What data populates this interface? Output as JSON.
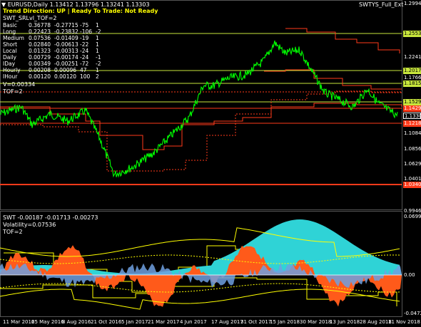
{
  "symbol_header": "EURUSD,Daily 1.13412 1.13796 1.13241 1.13303",
  "indicator_name_top_right": "SWTYS_Full_Ext",
  "status": {
    "trend_label": "Trend Direction: ",
    "trend_value": "UP",
    "sep": "|",
    "ready_label": "Ready To Trade: ",
    "ready_value": "Not Ready"
  },
  "swt_title": "SWT_SRLvl_TOF=2",
  "stats_rows": [
    [
      "Basic",
      "0.36778",
      "-0.27715",
      "-75",
      "1"
    ],
    [
      "Long",
      "0.22423",
      "-0.23832",
      "-106",
      "-2"
    ],
    [
      "Medium",
      "0.07536",
      "-0.01409",
      "-19",
      "1"
    ],
    [
      "Short",
      "0.02840",
      "-0.00613",
      "-22",
      "1"
    ],
    [
      "Local",
      "0.01323",
      "-0.00313",
      "-24",
      "1"
    ],
    [
      "Daily",
      "0.00729",
      "-0.00174",
      "-24",
      "-1"
    ],
    [
      "IDay",
      "0.00349",
      "-0.00251",
      "-72",
      "-2"
    ],
    [
      "Hourly",
      "0.00208",
      "0.00096",
      "47",
      "1"
    ],
    [
      "IHour",
      "0.00120",
      "0.00120",
      "100",
      "2"
    ]
  ],
  "v_label": "V=0.00334",
  "tof_label": "TOF=2",
  "price_axis": {
    "ticks": [
      "1.29940",
      "1.22416",
      "1.17663",
      "1.10847",
      "1.08565",
      "1.06290",
      "1.04015",
      "0.99465"
    ],
    "boxes": [
      {
        "text": "1.25530",
        "color": "#c8e63c"
      },
      {
        "text": "1.20175",
        "color": "#c8e63c"
      },
      {
        "text": "1.18150",
        "color": "#c8e63c"
      },
      {
        "text": "1.15290",
        "color": "#c8e63c"
      },
      {
        "text": "1.14297",
        "color": "#ff3a1a"
      },
      {
        "text": "1.13303",
        "color": "#ffffff"
      },
      {
        "text": "1.12184",
        "color": "#ff3a1a"
      },
      {
        "text": "1.03405",
        "color": "#ff3a1a"
      }
    ]
  },
  "sub": {
    "header": "SWT -0.00187 -0.01713 -0.00273",
    "volatility": "Volatility=0.07536",
    "tof": "TOF=2",
    "ticks": [
      "0.06995",
      "0.00",
      "-0.04723"
    ]
  },
  "time_axis": [
    "11 Mar 2016",
    "25 May 2016",
    "8 Aug 2016",
    "21 Oct 2016",
    "5 Jan 2017",
    "21 Mar 2017",
    "4 Jun 2017",
    "17 Aug 2017",
    "31 Oct 2017",
    "15 Jan 2018",
    "30 Mar 2018",
    "13 Jun 2018",
    "28 Aug 2018",
    "11 Nov 2018"
  ],
  "colors": {
    "price": "#00ff00",
    "support": "#ff3a1a",
    "level": "#c8e63c",
    "channel": "#ffff00",
    "cyan": "#2fd3d6",
    "orange": "#ff5a1a",
    "blue": "#6fa0e0"
  }
}
